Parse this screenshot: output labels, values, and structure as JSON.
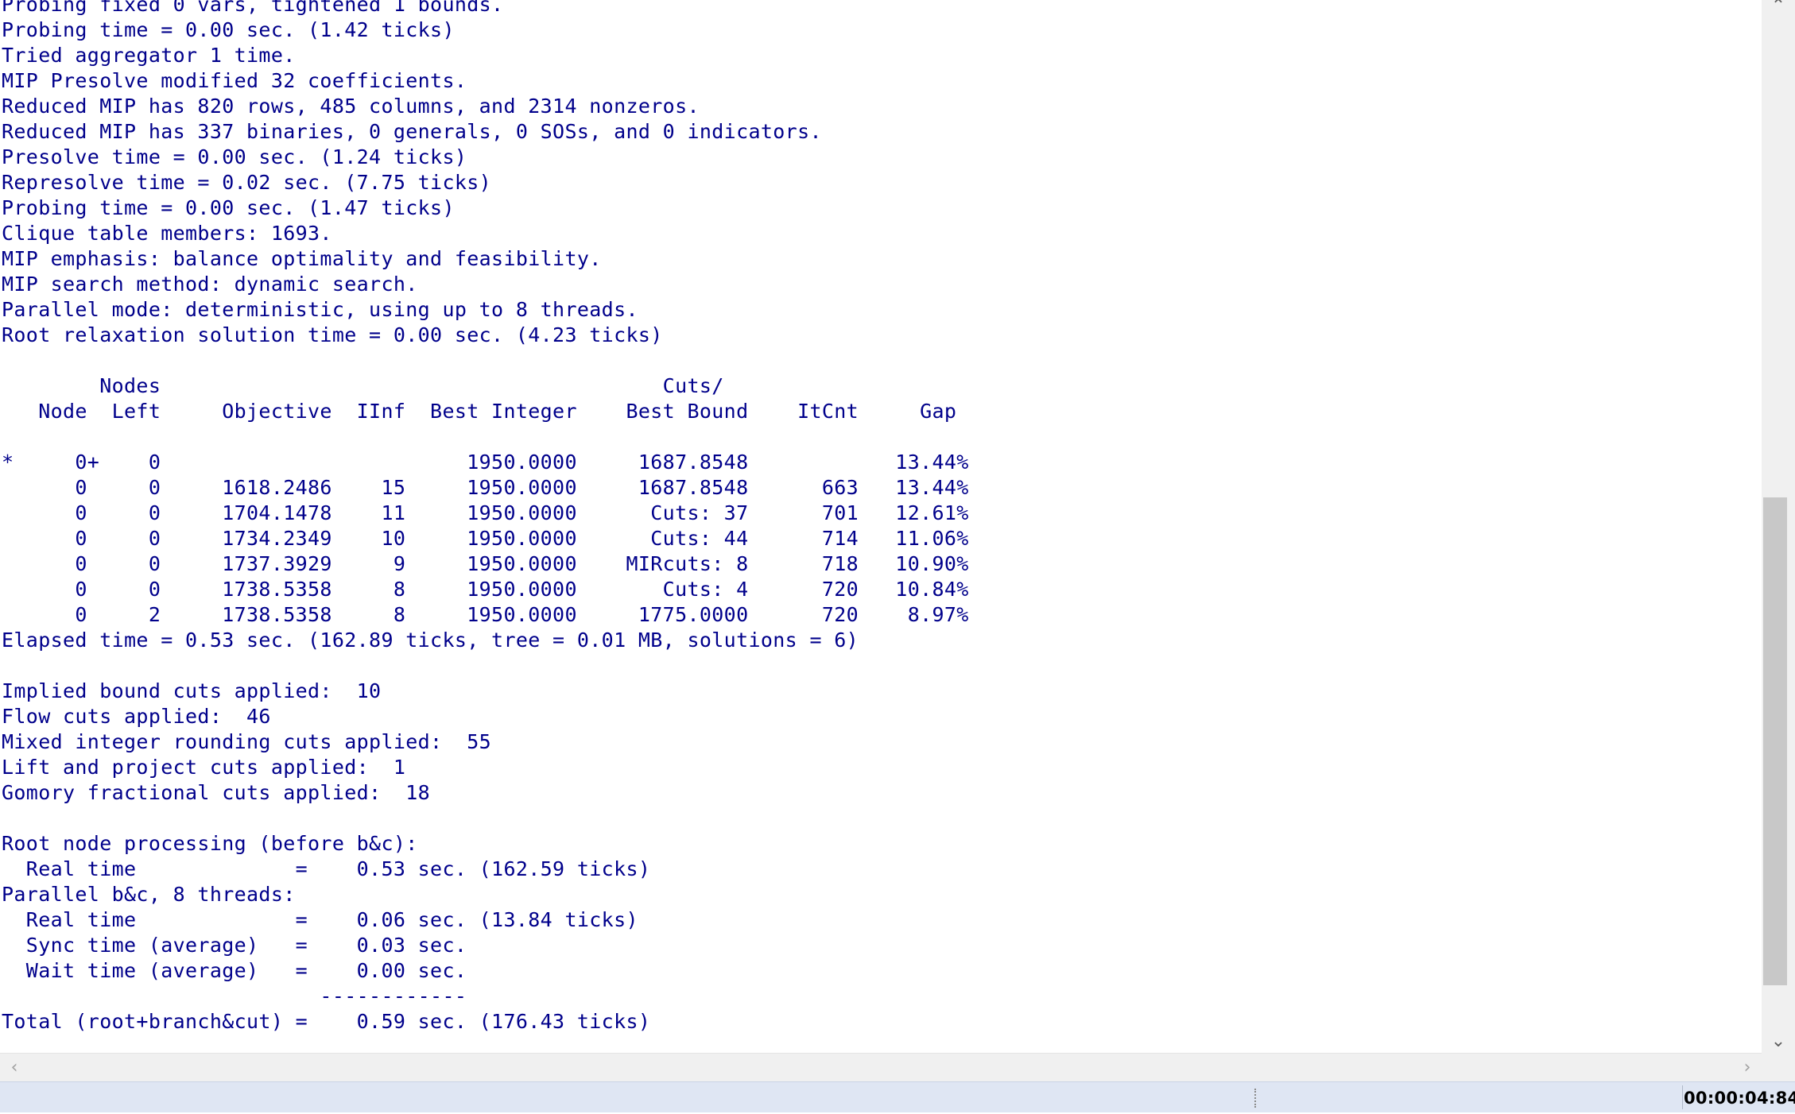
{
  "console": {
    "lines": [
      "Probing fixed 0 vars, tightened 1 bounds.",
      "Probing time = 0.00 sec. (1.42 ticks)",
      "Tried aggregator 1 time.",
      "MIP Presolve modified 32 coefficients.",
      "Reduced MIP has 820 rows, 485 columns, and 2314 nonzeros.",
      "Reduced MIP has 337 binaries, 0 generals, 0 SOSs, and 0 indicators.",
      "Presolve time = 0.00 sec. (1.24 ticks)",
      "Represolve time = 0.02 sec. (7.75 ticks)",
      "Probing time = 0.00 sec. (1.47 ticks)",
      "Clique table members: 1693.",
      "MIP emphasis: balance optimality and feasibility.",
      "MIP search method: dynamic search.",
      "Parallel mode: deterministic, using up to 8 threads.",
      "Root relaxation solution time = 0.00 sec. (4.23 ticks)",
      "",
      "        Nodes                                         Cuts/",
      "   Node  Left     Objective  IInf  Best Integer    Best Bound    ItCnt     Gap",
      "",
      "*     0+    0                         1950.0000     1687.8548            13.44%",
      "      0     0     1618.2486    15     1950.0000     1687.8548      663   13.44%",
      "      0     0     1704.1478    11     1950.0000      Cuts: 37      701   12.61%",
      "      0     0     1734.2349    10     1950.0000      Cuts: 44      714   11.06%",
      "      0     0     1737.3929     9     1950.0000    MIRcuts: 8      718   10.90%",
      "      0     0     1738.5358     8     1950.0000       Cuts: 4      720   10.84%",
      "      0     2     1738.5358     8     1950.0000     1775.0000      720    8.97%",
      "Elapsed time = 0.53 sec. (162.89 ticks, tree = 0.01 MB, solutions = 6)",
      "",
      "Implied bound cuts applied:  10",
      "Flow cuts applied:  46",
      "Mixed integer rounding cuts applied:  55",
      "Lift and project cuts applied:  1",
      "Gomory fractional cuts applied:  18",
      "",
      "Root node processing (before b&c):",
      "  Real time             =    0.53 sec. (162.59 ticks)",
      "Parallel b&c, 8 threads:",
      "  Real time             =    0.06 sec. (13.84 ticks)",
      "  Sync time (average)   =    0.03 sec.",
      "  Wait time (average)   =    0.00 sec.",
      "                          ------------",
      "Total (root+branch&cut) =    0.59 sec. (176.43 ticks)"
    ]
  },
  "scrollbars": {
    "up_glyph": "⌃",
    "down_glyph": "⌄",
    "left_glyph": "‹",
    "right_glyph": "›"
  },
  "statusbar": {
    "elapsed": "00:00:04:84"
  }
}
